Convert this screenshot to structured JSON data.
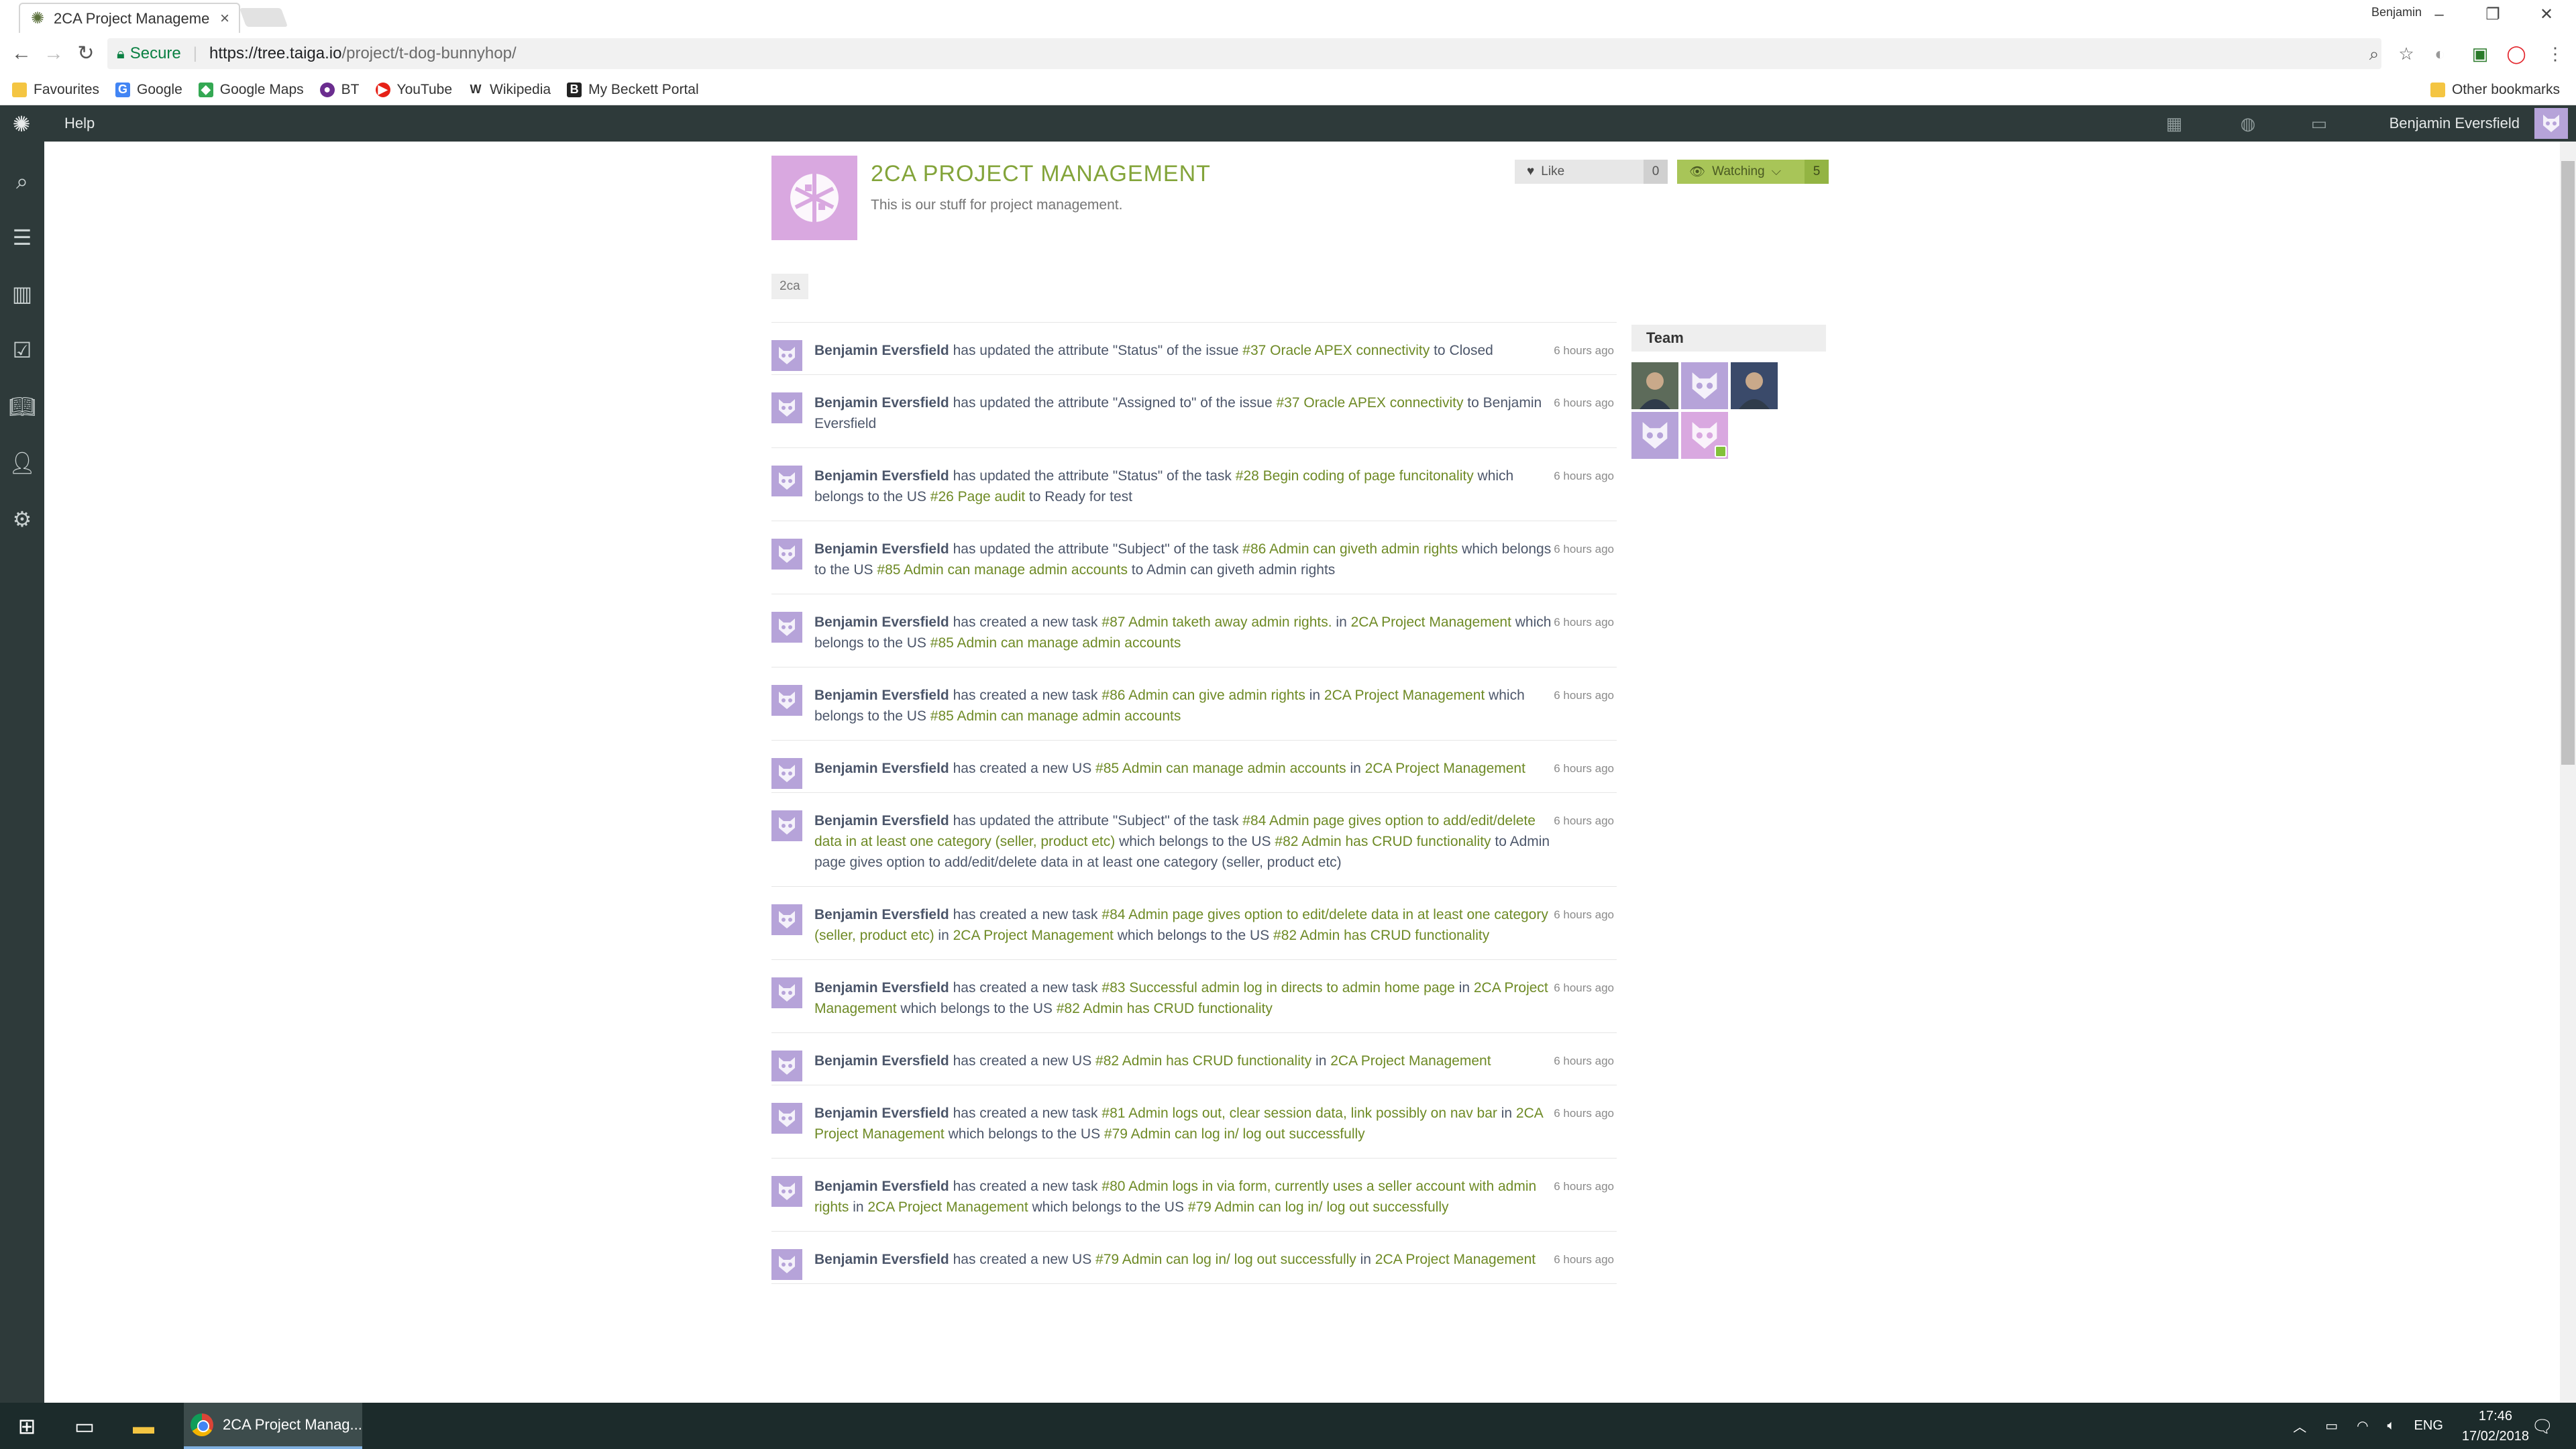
{
  "browser": {
    "tab_title": "2CA Project Manageme",
    "window_user": "Benjamin",
    "url_secure": "Secure",
    "url_host": "https://tree.taiga.io",
    "url_path": "/project/t-dog-bunnyhop/",
    "bookmarks": [
      {
        "label": "Favourites",
        "icon": "folder-icon",
        "color": "#f4c542"
      },
      {
        "label": "Google",
        "icon": "google-icon",
        "color": "#4285f4"
      },
      {
        "label": "Google Maps",
        "icon": "maps-icon",
        "color": "#34a853"
      },
      {
        "label": "BT",
        "icon": "bt-icon",
        "color": "#6b2d8f"
      },
      {
        "label": "YouTube",
        "icon": "youtube-icon",
        "color": "#e62117"
      },
      {
        "label": "Wikipedia",
        "icon": "wikipedia-icon",
        "color": "#333333"
      },
      {
        "label": "My Beckett Portal",
        "icon": "beckett-icon",
        "color": "#222222"
      }
    ],
    "other_bookmarks": "Other bookmarks"
  },
  "taiga": {
    "help": "Help",
    "user_name": "Benjamin Eversfield"
  },
  "project": {
    "title": "2CA PROJECT MANAGEMENT",
    "description": "This is our stuff for project management.",
    "like_label": "Like",
    "like_count": "0",
    "watch_label": "Watching",
    "watch_count": "5",
    "tag": "2ca",
    "accent_color": "#83a43a"
  },
  "team": {
    "title": "Team",
    "members": [
      {
        "kind": "photo",
        "color": "#5d6b5a"
      },
      {
        "kind": "default",
        "color": "#b6a3d9"
      },
      {
        "kind": "photo",
        "color": "#3a4a6a"
      },
      {
        "kind": "default",
        "color": "#b6a3d9"
      },
      {
        "kind": "default",
        "color": "#d9a8e0",
        "badge": true
      }
    ]
  },
  "activity": [
    {
      "time": "6 hours ago",
      "parts": [
        {
          "t": "Benjamin Eversfield",
          "k": "user"
        },
        {
          "t": " has updated the attribute \"Status\" of the issue "
        },
        {
          "t": "#37 Oracle APEX connectivity",
          "k": "link"
        },
        {
          "t": " to Closed"
        }
      ]
    },
    {
      "time": "6 hours ago",
      "parts": [
        {
          "t": "Benjamin Eversfield",
          "k": "user"
        },
        {
          "t": " has updated the attribute \"Assigned to\" of the issue "
        },
        {
          "t": "#37 Oracle APEX connectivity",
          "k": "link"
        },
        {
          "t": " to Benjamin Eversfield"
        }
      ]
    },
    {
      "time": "6 hours ago",
      "parts": [
        {
          "t": "Benjamin Eversfield",
          "k": "user"
        },
        {
          "t": " has updated the attribute \"Status\" of the task "
        },
        {
          "t": "#28 Begin coding of page funcitonality",
          "k": "link"
        },
        {
          "t": " which belongs to the US "
        },
        {
          "t": "#26 Page audit",
          "k": "link"
        },
        {
          "t": " to Ready for test"
        }
      ]
    },
    {
      "time": "6 hours ago",
      "parts": [
        {
          "t": "Benjamin Eversfield",
          "k": "user"
        },
        {
          "t": " has updated the attribute \"Subject\" of the task "
        },
        {
          "t": "#86 Admin can giveth admin rights",
          "k": "link"
        },
        {
          "t": " which belongs to the US "
        },
        {
          "t": "#85 Admin can manage admin accounts",
          "k": "link"
        },
        {
          "t": " to Admin can giveth admin rights"
        }
      ]
    },
    {
      "time": "6 hours ago",
      "parts": [
        {
          "t": "Benjamin Eversfield",
          "k": "user"
        },
        {
          "t": " has created a new task "
        },
        {
          "t": "#87 Admin taketh away admin rights.",
          "k": "link"
        },
        {
          "t": " in "
        },
        {
          "t": "2CA Project Management",
          "k": "link"
        },
        {
          "t": " which belongs to the US "
        },
        {
          "t": "#85 Admin can manage admin accounts",
          "k": "link"
        }
      ]
    },
    {
      "time": "6 hours ago",
      "parts": [
        {
          "t": "Benjamin Eversfield",
          "k": "user"
        },
        {
          "t": " has created a new task "
        },
        {
          "t": "#86 Admin can give admin rights",
          "k": "link"
        },
        {
          "t": " in "
        },
        {
          "t": "2CA Project Management",
          "k": "link"
        },
        {
          "t": " which belongs to the US "
        },
        {
          "t": "#85 Admin can manage admin accounts",
          "k": "link"
        }
      ]
    },
    {
      "time": "6 hours ago",
      "parts": [
        {
          "t": "Benjamin Eversfield",
          "k": "user"
        },
        {
          "t": " has created a new US "
        },
        {
          "t": "#85 Admin can manage admin accounts",
          "k": "link"
        },
        {
          "t": " in "
        },
        {
          "t": "2CA Project Management",
          "k": "link"
        }
      ]
    },
    {
      "time": "6 hours ago",
      "parts": [
        {
          "t": "Benjamin Eversfield",
          "k": "user"
        },
        {
          "t": " has updated the attribute \"Subject\" of the task "
        },
        {
          "t": "#84 Admin page gives option to add/edit/delete data in at least one category (seller, product etc)",
          "k": "link"
        },
        {
          "t": " which belongs to the US "
        },
        {
          "t": "#82 Admin has CRUD functionality",
          "k": "link"
        },
        {
          "t": " to Admin page gives option to add/edit/delete data in at least one category (seller, product etc)"
        }
      ]
    },
    {
      "time": "6 hours ago",
      "parts": [
        {
          "t": "Benjamin Eversfield",
          "k": "user"
        },
        {
          "t": " has created a new task "
        },
        {
          "t": "#84 Admin page gives option to edit/delete data in at least one category (seller, product etc)",
          "k": "link"
        },
        {
          "t": " in "
        },
        {
          "t": "2CA Project Management",
          "k": "link"
        },
        {
          "t": " which belongs to the US "
        },
        {
          "t": "#82 Admin has CRUD functionality",
          "k": "link"
        }
      ]
    },
    {
      "time": "6 hours ago",
      "parts": [
        {
          "t": "Benjamin Eversfield",
          "k": "user"
        },
        {
          "t": " has created a new task "
        },
        {
          "t": "#83 Successful admin log in directs to admin home page",
          "k": "link"
        },
        {
          "t": " in "
        },
        {
          "t": "2CA Project Management",
          "k": "link"
        },
        {
          "t": " which belongs to the US "
        },
        {
          "t": "#82 Admin has CRUD functionality",
          "k": "link"
        }
      ]
    },
    {
      "time": "6 hours ago",
      "parts": [
        {
          "t": "Benjamin Eversfield",
          "k": "user"
        },
        {
          "t": " has created a new US "
        },
        {
          "t": "#82 Admin has CRUD functionality",
          "k": "link"
        },
        {
          "t": " in "
        },
        {
          "t": "2CA Project Management",
          "k": "link"
        }
      ]
    },
    {
      "time": "6 hours ago",
      "parts": [
        {
          "t": "Benjamin Eversfield",
          "k": "user"
        },
        {
          "t": " has created a new task "
        },
        {
          "t": "#81 Admin logs out, clear session data, link possibly on nav bar",
          "k": "link"
        },
        {
          "t": " in "
        },
        {
          "t": "2CA Project Management",
          "k": "link"
        },
        {
          "t": " which belongs to the US "
        },
        {
          "t": "#79 Admin can log in/ log out successfully",
          "k": "link"
        }
      ]
    },
    {
      "time": "6 hours ago",
      "parts": [
        {
          "t": "Benjamin Eversfield",
          "k": "user"
        },
        {
          "t": " has created a new task "
        },
        {
          "t": "#80 Admin logs in via form, currently uses a seller account with admin rights",
          "k": "link"
        },
        {
          "t": " in "
        },
        {
          "t": "2CA Project Management",
          "k": "link"
        },
        {
          "t": " which belongs to the US "
        },
        {
          "t": "#79 Admin can log in/ log out successfully",
          "k": "link"
        }
      ]
    },
    {
      "time": "6 hours ago",
      "parts": [
        {
          "t": "Benjamin Eversfield",
          "k": "user"
        },
        {
          "t": " has created a new US "
        },
        {
          "t": "#79 Admin can log in/ log out successfully",
          "k": "link"
        },
        {
          "t": " in "
        },
        {
          "t": "2CA Project Management",
          "k": "link"
        }
      ]
    }
  ],
  "taskbar": {
    "chrome_label": "2CA Project Manag...",
    "lang": "ENG",
    "time": "17:46",
    "date": "17/02/2018"
  }
}
